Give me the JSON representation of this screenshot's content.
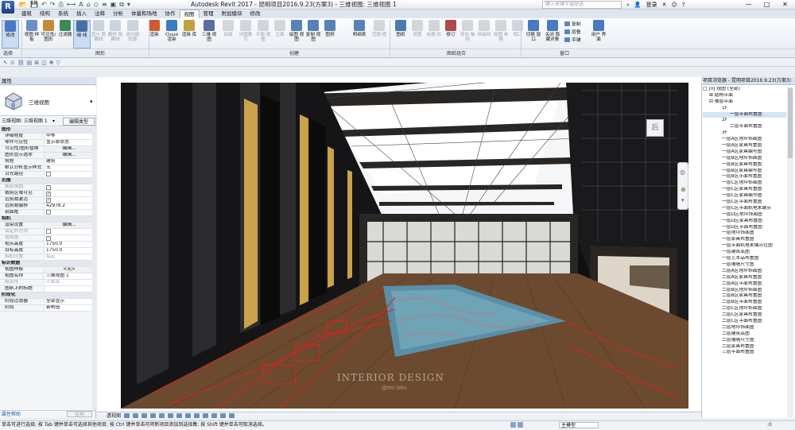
{
  "title_bar": {
    "app_menu_letter": "R",
    "title": "Autodesk Revit 2017 -   昆明项目2016.9.23(方案3) - 三维视图: 三维视图 1",
    "search_placeholder": "键入关键字或短语",
    "sign_in": "登录",
    "window_controls": [
      "—",
      "□",
      "✕"
    ]
  },
  "menu_tabs": [
    "建筑",
    "结构",
    "系统",
    "插入",
    "注释",
    "分析",
    "体量和场地",
    "协作",
    "视图",
    "管理",
    "附加模块",
    "修改"
  ],
  "active_tab": "视图",
  "ribbon": {
    "buttons": [
      {
        "label": "修改",
        "name": "modify",
        "enabled": true,
        "active": true
      },
      {
        "label": "视图 样板",
        "name": "view-template",
        "enabled": true
      },
      {
        "label": "可见性/ 图形",
        "name": "visibility-graphics",
        "enabled": true
      },
      {
        "label": "过滤器",
        "name": "filters",
        "enabled": true
      },
      {
        "label": "细 线",
        "name": "thin-lines",
        "enabled": true,
        "active": true
      },
      {
        "label": "显示 隐藏线",
        "name": "show-hidden-lines",
        "enabled": false
      },
      {
        "label": "删除 隐藏线",
        "name": "remove-hidden-lines",
        "enabled": false
      },
      {
        "label": "剖切面 轮廓",
        "name": "cut-profile",
        "enabled": false
      },
      {
        "label": "渲染",
        "name": "render",
        "enabled": true
      },
      {
        "label": "Cloud 渲染",
        "name": "cloud-render",
        "enabled": true
      },
      {
        "label": "渲染 库",
        "name": "render-gallery",
        "enabled": true
      },
      {
        "label": "三维 视图",
        "name": "3d-view",
        "enabled": true
      },
      {
        "label": "剖面",
        "name": "section",
        "enabled": false
      },
      {
        "label": "详图索引",
        "name": "callout",
        "enabled": false
      },
      {
        "label": "平面 视图",
        "name": "plan-views",
        "enabled": false
      },
      {
        "label": "立面",
        "name": "elevation",
        "enabled": false
      },
      {
        "label": "绘图 视图",
        "name": "drafting-view",
        "enabled": true
      },
      {
        "label": "复制 视图",
        "name": "duplicate-view",
        "enabled": true
      },
      {
        "label": "图例",
        "name": "legends",
        "enabled": true
      },
      {
        "label": "明细表",
        "name": "schedules",
        "enabled": true
      },
      {
        "label": "范围 框",
        "name": "scope-box",
        "enabled": false
      },
      {
        "label": "图纸",
        "name": "sheet",
        "enabled": true
      },
      {
        "label": "视图",
        "name": "view",
        "enabled": false
      },
      {
        "label": "标题 栏",
        "name": "title-block",
        "enabled": false
      },
      {
        "label": "修订",
        "name": "revisions",
        "enabled": true
      },
      {
        "label": "导向 轴网",
        "name": "guide-grid",
        "enabled": false
      },
      {
        "label": "拼接线",
        "name": "matchline",
        "enabled": false
      },
      {
        "label": "视图 参照",
        "name": "view-reference",
        "enabled": false
      },
      {
        "label": "视口",
        "name": "viewports",
        "enabled": false
      },
      {
        "label": "切换 窗口",
        "name": "switch-windows",
        "enabled": true
      },
      {
        "label": "关闭 隐藏对象",
        "name": "close-hidden",
        "enabled": true
      },
      {
        "label": "用户 界面",
        "name": "user-interface",
        "enabled": true
      }
    ],
    "small_buttons": [
      "复制",
      "层叠",
      "平铺"
    ],
    "panels": [
      "选择",
      "图形",
      "创建",
      "图纸组合",
      "窗口"
    ]
  },
  "properties": {
    "title": "属性",
    "type_name": "三维视图",
    "instance_selector": "三维视图: 三维视图 1",
    "edit_type": "编辑类型",
    "rows": [
      {
        "group": "图形"
      },
      {
        "k": "详细程度",
        "v": "中等"
      },
      {
        "k": "零件可见性",
        "v": "显示原状态"
      },
      {
        "k": "可见性/图形替换",
        "v": "编辑...",
        "btn": true
      },
      {
        "k": "图形显示选项",
        "v": "编辑...",
        "btn": true
      },
      {
        "k": "规程",
        "v": "建筑"
      },
      {
        "k": "默认分析显示样式",
        "v": "无"
      },
      {
        "k": "日光路径",
        "v": "",
        "chk": true
      },
      {
        "group": "范围"
      },
      {
        "k": "裁剪视图",
        "v": "",
        "chk": true,
        "checked": true,
        "dim": true
      },
      {
        "k": "裁剪区域可见",
        "v": "",
        "chk": true,
        "checked": true
      },
      {
        "k": "远剪裁激活",
        "v": "",
        "chk": true,
        "checked": true
      },
      {
        "k": "远剪裁偏移",
        "v": "42978.2"
      },
      {
        "k": "剖面框",
        "v": "",
        "chk": true
      },
      {
        "group": "相机"
      },
      {
        "k": "渲染设置",
        "v": "编辑...",
        "btn": true
      },
      {
        "k": "锁定的方向",
        "v": "",
        "chk": true,
        "dim": true
      },
      {
        "k": "透视图",
        "v": "",
        "chk": true,
        "checked": true,
        "dim": true
      },
      {
        "k": "视点高度",
        "v": "1750.0"
      },
      {
        "k": "目标高度",
        "v": "1750.0"
      },
      {
        "k": "相机位置",
        "v": "指定",
        "dim": true
      },
      {
        "group": "标识数据"
      },
      {
        "k": "视图样板",
        "v": "<无>",
        "btn": true
      },
      {
        "k": "视图名称",
        "v": "三维视图 1"
      },
      {
        "k": "相关性",
        "v": "不相关",
        "dim": true
      },
      {
        "k": "图纸上的标题",
        "v": ""
      },
      {
        "group": "阶段化"
      },
      {
        "k": "阶段过滤器",
        "v": "全部显示"
      },
      {
        "k": "阶段",
        "v": "新构造"
      }
    ],
    "help_link": "属性帮助",
    "apply": "应用"
  },
  "viewport": {
    "view_cube_label": "后",
    "watermark_1": "INTERIOR DESIGN",
    "watermark_2": "@mt-bbs",
    "view_control_label": "透视图"
  },
  "project_browser": {
    "title": "项目浏览器 - 昆明项目2016.9.23(方案3)",
    "items": [
      {
        "t": "□ [0] 视图 (全部)",
        "lvl": 0
      },
      {
        "t": "⊞ 结构平面",
        "lvl": 1
      },
      {
        "t": "⊟ 楼层平面",
        "lvl": 1
      },
      {
        "t": "1F",
        "lvl": 2
      },
      {
        "t": "一层平面布置图",
        "lvl": 3,
        "sel": true
      },
      {
        "t": "2F",
        "lvl": 2
      },
      {
        "t": "二层平面布置图",
        "lvl": 3
      },
      {
        "t": "3F",
        "lvl": 2
      },
      {
        "t": "一层A区地坪饰面图",
        "lvl": 2
      },
      {
        "t": "一层A区家具布置图",
        "lvl": 2
      },
      {
        "t": "一层A区家具编号图",
        "lvl": 2
      },
      {
        "t": "一层B区地坪饰面图",
        "lvl": 2
      },
      {
        "t": "一层B区家具布置图",
        "lvl": 2
      },
      {
        "t": "一层B区家具编号图",
        "lvl": 2
      },
      {
        "t": "一层B区平面布置图",
        "lvl": 2
      },
      {
        "t": "一层C区地坪饰面图",
        "lvl": 2
      },
      {
        "t": "一层C区家具布置图",
        "lvl": 2
      },
      {
        "t": "一层C区家具编号图",
        "lvl": 2
      },
      {
        "t": "一层C区平面布置图",
        "lvl": 2
      },
      {
        "t": "一层C区平面机电末端点",
        "lvl": 2
      },
      {
        "t": "一层D区地坪饰面图",
        "lvl": 2
      },
      {
        "t": "一层D区家具布置图",
        "lvl": 2
      },
      {
        "t": "一层D区平面布置图",
        "lvl": 2
      },
      {
        "t": "一层地坪饰面图",
        "lvl": 2
      },
      {
        "t": "一层家具布置图",
        "lvl": 2
      },
      {
        "t": "一层平面机电末端点位图",
        "lvl": 2
      },
      {
        "t": "一层建筑底图",
        "lvl": 2
      },
      {
        "t": "一层艺术品布置图",
        "lvl": 2
      },
      {
        "t": "一层隔墙尺寸图",
        "lvl": 2
      },
      {
        "t": "二层A区地坪饰面图",
        "lvl": 2
      },
      {
        "t": "二层A区家具布置图",
        "lvl": 2
      },
      {
        "t": "二层A区平面布置图",
        "lvl": 2
      },
      {
        "t": "二层B区地坪饰面图",
        "lvl": 2
      },
      {
        "t": "二层B区家具布置图",
        "lvl": 2
      },
      {
        "t": "二层B区平面布置图",
        "lvl": 2
      },
      {
        "t": "二层C区地坪饰面图",
        "lvl": 2
      },
      {
        "t": "二层C区家具布置图",
        "lvl": 2
      },
      {
        "t": "二层C区平面布置图",
        "lvl": 2
      },
      {
        "t": "二层地坪饰面图",
        "lvl": 2
      },
      {
        "t": "二层建筑底图",
        "lvl": 2
      },
      {
        "t": "二层隔墙尺寸图",
        "lvl": 2
      },
      {
        "t": "二层家具布置图",
        "lvl": 2
      },
      {
        "t": "三层平面布置图",
        "lvl": 2
      }
    ]
  },
  "status": {
    "text": "单击可进行选择; 按 Tab 键并单击可选择其他项目; 按 Ctrl 键并单击可将新项目添加到选择集; 按 Shift 键并单击可取消选择。",
    "model": "主模型",
    "filter_count": ":0"
  },
  "colors": {
    "accent": "#2a5db0",
    "floor": "#6b4a2f",
    "rug": "#5a8fa8",
    "wall": "#1c1c1e",
    "red_lines": "#e02020"
  }
}
